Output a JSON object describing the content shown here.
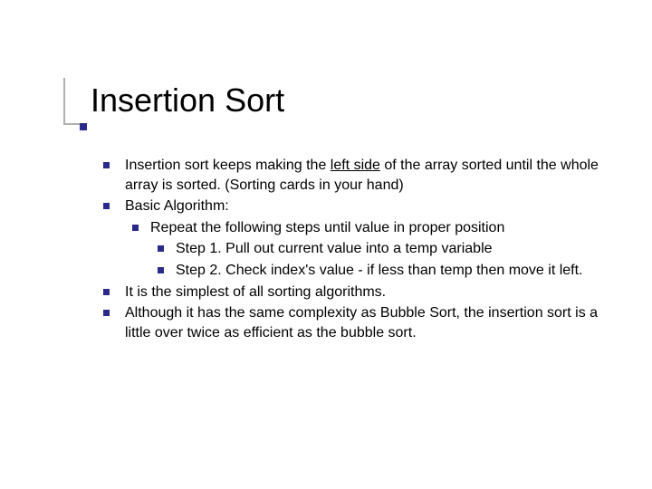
{
  "title": "Insertion Sort",
  "bullets": {
    "b1_pre": "Insertion sort keeps making the ",
    "b1_underline": "left side",
    "b1_post": " of the array sorted until the whole array is sorted.  (Sorting cards in your hand)",
    "b2": "Basic Algorithm:",
    "b2_1": "Repeat the following steps until value in proper position",
    "b2_1_1": "Step 1. Pull out current value into a temp variable",
    "b2_1_2": "Step 2. Check index's value - if less than temp then move it left.",
    "b3": "It is the simplest of all sorting algorithms.",
    "b4": "Although it has the same complexity as Bubble Sort, the insertion sort is a little over twice as efficient as the bubble sort."
  }
}
